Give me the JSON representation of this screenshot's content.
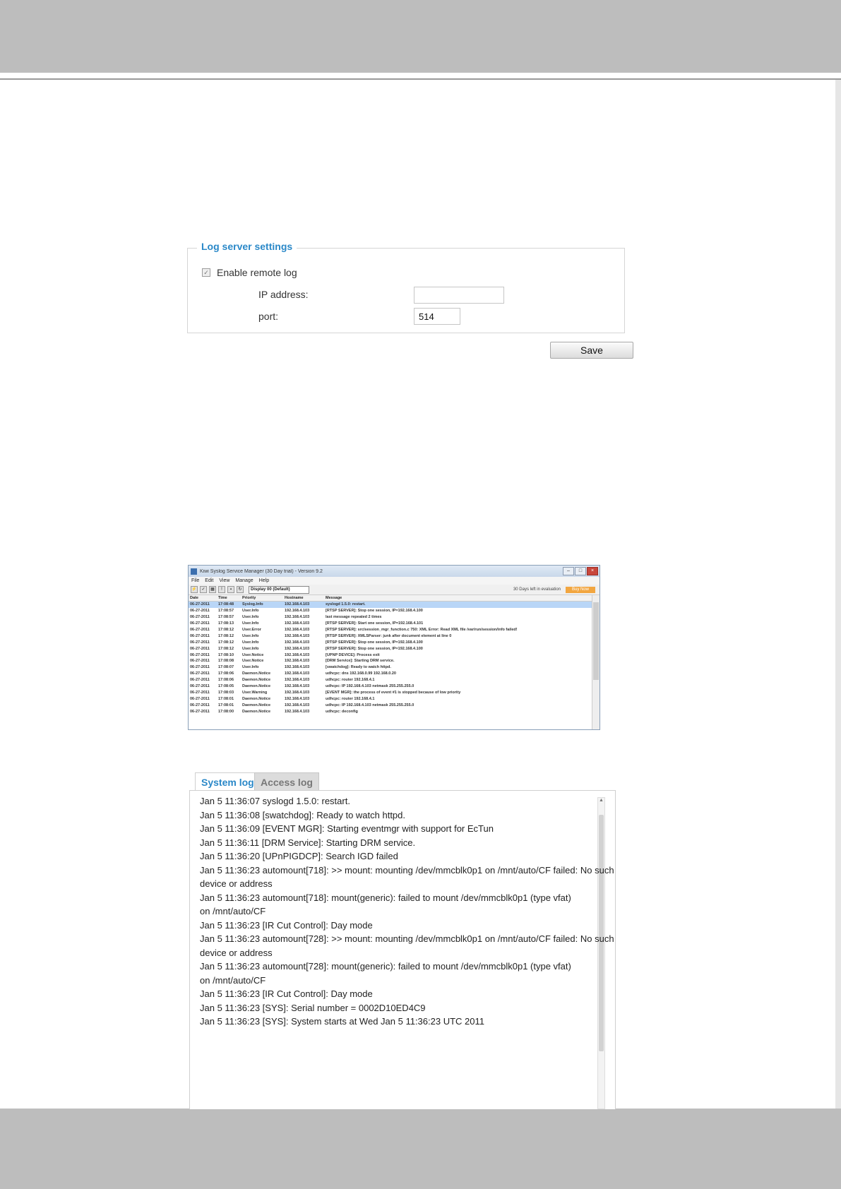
{
  "log_server": {
    "legend": "Log server settings",
    "enable_label": "Enable remote log",
    "enable_checked": true,
    "ip_label": "IP address:",
    "ip_value": "",
    "port_label": "port:",
    "port_value": "514",
    "save_label": "Save"
  },
  "syslog_app": {
    "title": "Kiwi Syslog Service Manager (30 Day trial) - Version 9.2",
    "menu": [
      "File",
      "Edit",
      "View",
      "Manage",
      "Help"
    ],
    "display_select": "Display 00 (Default)",
    "eval_text": "30 Days left in evaluation",
    "buy_label": "Buy Now",
    "columns": [
      "Date",
      "Time",
      "Priority",
      "Hostname",
      "Message"
    ],
    "rows": [
      [
        "06-27-2011",
        "17:08:48",
        "Syslog.Info",
        "192.168.4.103",
        "syslogd 1.5.0: restart."
      ],
      [
        "06-27-2011",
        "17:08:57",
        "User.Info",
        "192.168.4.103",
        "[RTSP SERVER]: Stop one session, IP=192.168.4.100"
      ],
      [
        "06-27-2011",
        "17:08:57",
        "User.Info",
        "192.168.4.103",
        "last message repeated 2 times"
      ],
      [
        "06-27-2011",
        "17:08:13",
        "User.Info",
        "192.168.4.103",
        "[RTSP SERVER]: Start one session, IP=192.168.4.101"
      ],
      [
        "06-27-2011",
        "17:08:12",
        "User.Error",
        "192.168.4.103",
        "[RTSP SERVER]: src/session_mgr_function.c 750: XML Error: Read XML file /var/run/session/info failed!"
      ],
      [
        "06-27-2011",
        "17:08:12",
        "User.Info",
        "192.168.4.103",
        "[RTSP SERVER]: XMLSParser: junk after document element at line 0"
      ],
      [
        "06-27-2011",
        "17:08:12",
        "User.Info",
        "192.168.4.103",
        "[RTSP SERVER]: Stop one session, IP=192.168.4.100"
      ],
      [
        "06-27-2011",
        "17:08:12",
        "User.Info",
        "192.168.4.103",
        "[RTSP SERVER]: Stop one session, IP=192.168.4.100"
      ],
      [
        "06-27-2011",
        "17:08:10",
        "User.Notice",
        "192.168.4.103",
        "[UPNP DEVICE]: Process exit"
      ],
      [
        "06-27-2011",
        "17:08:08",
        "User.Notice",
        "192.168.4.103",
        "[DRM Service]: Starting DRM service."
      ],
      [
        "06-27-2011",
        "17:08:07",
        "User.Info",
        "192.168.4.103",
        "[swatchdog]: Ready to watch httpd."
      ],
      [
        "06-27-2011",
        "17:08:06",
        "Daemon.Notice",
        "192.168.4.103",
        "udhcpc: dns 192.168.0.99 192.168.0.20"
      ],
      [
        "06-27-2011",
        "17:08:06",
        "Daemon.Notice",
        "192.168.4.103",
        "udhcpc: router 192.168.4.1"
      ],
      [
        "06-27-2011",
        "17:08:05",
        "Daemon.Notice",
        "192.168.4.103",
        "udhcpc: IP 192.168.4.103 netmask 255.255.255.0"
      ],
      [
        "06-27-2011",
        "17:08:03",
        "User.Warning",
        "192.168.4.103",
        "[EVENT MGR]: the process of event #1 is stopped because of low priority"
      ],
      [
        "06-27-2011",
        "17:08:01",
        "Daemon.Notice",
        "192.168.4.103",
        "udhcpc: router 192.168.4.1"
      ],
      [
        "06-27-2011",
        "17:08:01",
        "Daemon.Notice",
        "192.168.4.103",
        "udhcpc: IP 192.168.4.103 netmask 255.255.255.0"
      ],
      [
        "06-27-2011",
        "17:08:00",
        "Daemon.Notice",
        "192.168.4.103",
        "udhcpc: deconfig"
      ]
    ]
  },
  "log_viewer": {
    "tabs": [
      "System log",
      "Access log"
    ],
    "lines": [
      "Jan 5 11:36:07 syslogd 1.5.0: restart.",
      "Jan 5 11:36:08 [swatchdog]: Ready to watch httpd.",
      "Jan 5 11:36:09 [EVENT MGR]: Starting eventmgr with support for EcTun",
      "Jan 5 11:36:11 [DRM Service]: Starting DRM service.",
      "Jan 5 11:36:20 [UPnPIGDCP]: Search IGD failed",
      "Jan 5 11:36:23 automount[718]: >> mount: mounting /dev/mmcblk0p1 on /mnt/auto/CF failed: No such",
      "device or address",
      "Jan 5 11:36:23 automount[718]: mount(generic): failed to mount /dev/mmcblk0p1 (type vfat)",
      "on /mnt/auto/CF",
      "Jan 5 11:36:23 [IR Cut Control]: Day mode",
      "Jan 5 11:36:23 automount[728]: >> mount: mounting /dev/mmcblk0p1 on /mnt/auto/CF failed: No such",
      "device or address",
      "Jan 5 11:36:23 automount[728]: mount(generic): failed to mount /dev/mmcblk0p1 (type vfat)",
      "on /mnt/auto/CF",
      "Jan 5 11:36:23 [IR Cut Control]: Day mode",
      "Jan 5 11:36:23 [SYS]: Serial number = 0002D10ED4C9",
      "Jan 5 11:36:23 [SYS]: System starts at Wed Jan 5 11:36:23 UTC 2011"
    ]
  }
}
